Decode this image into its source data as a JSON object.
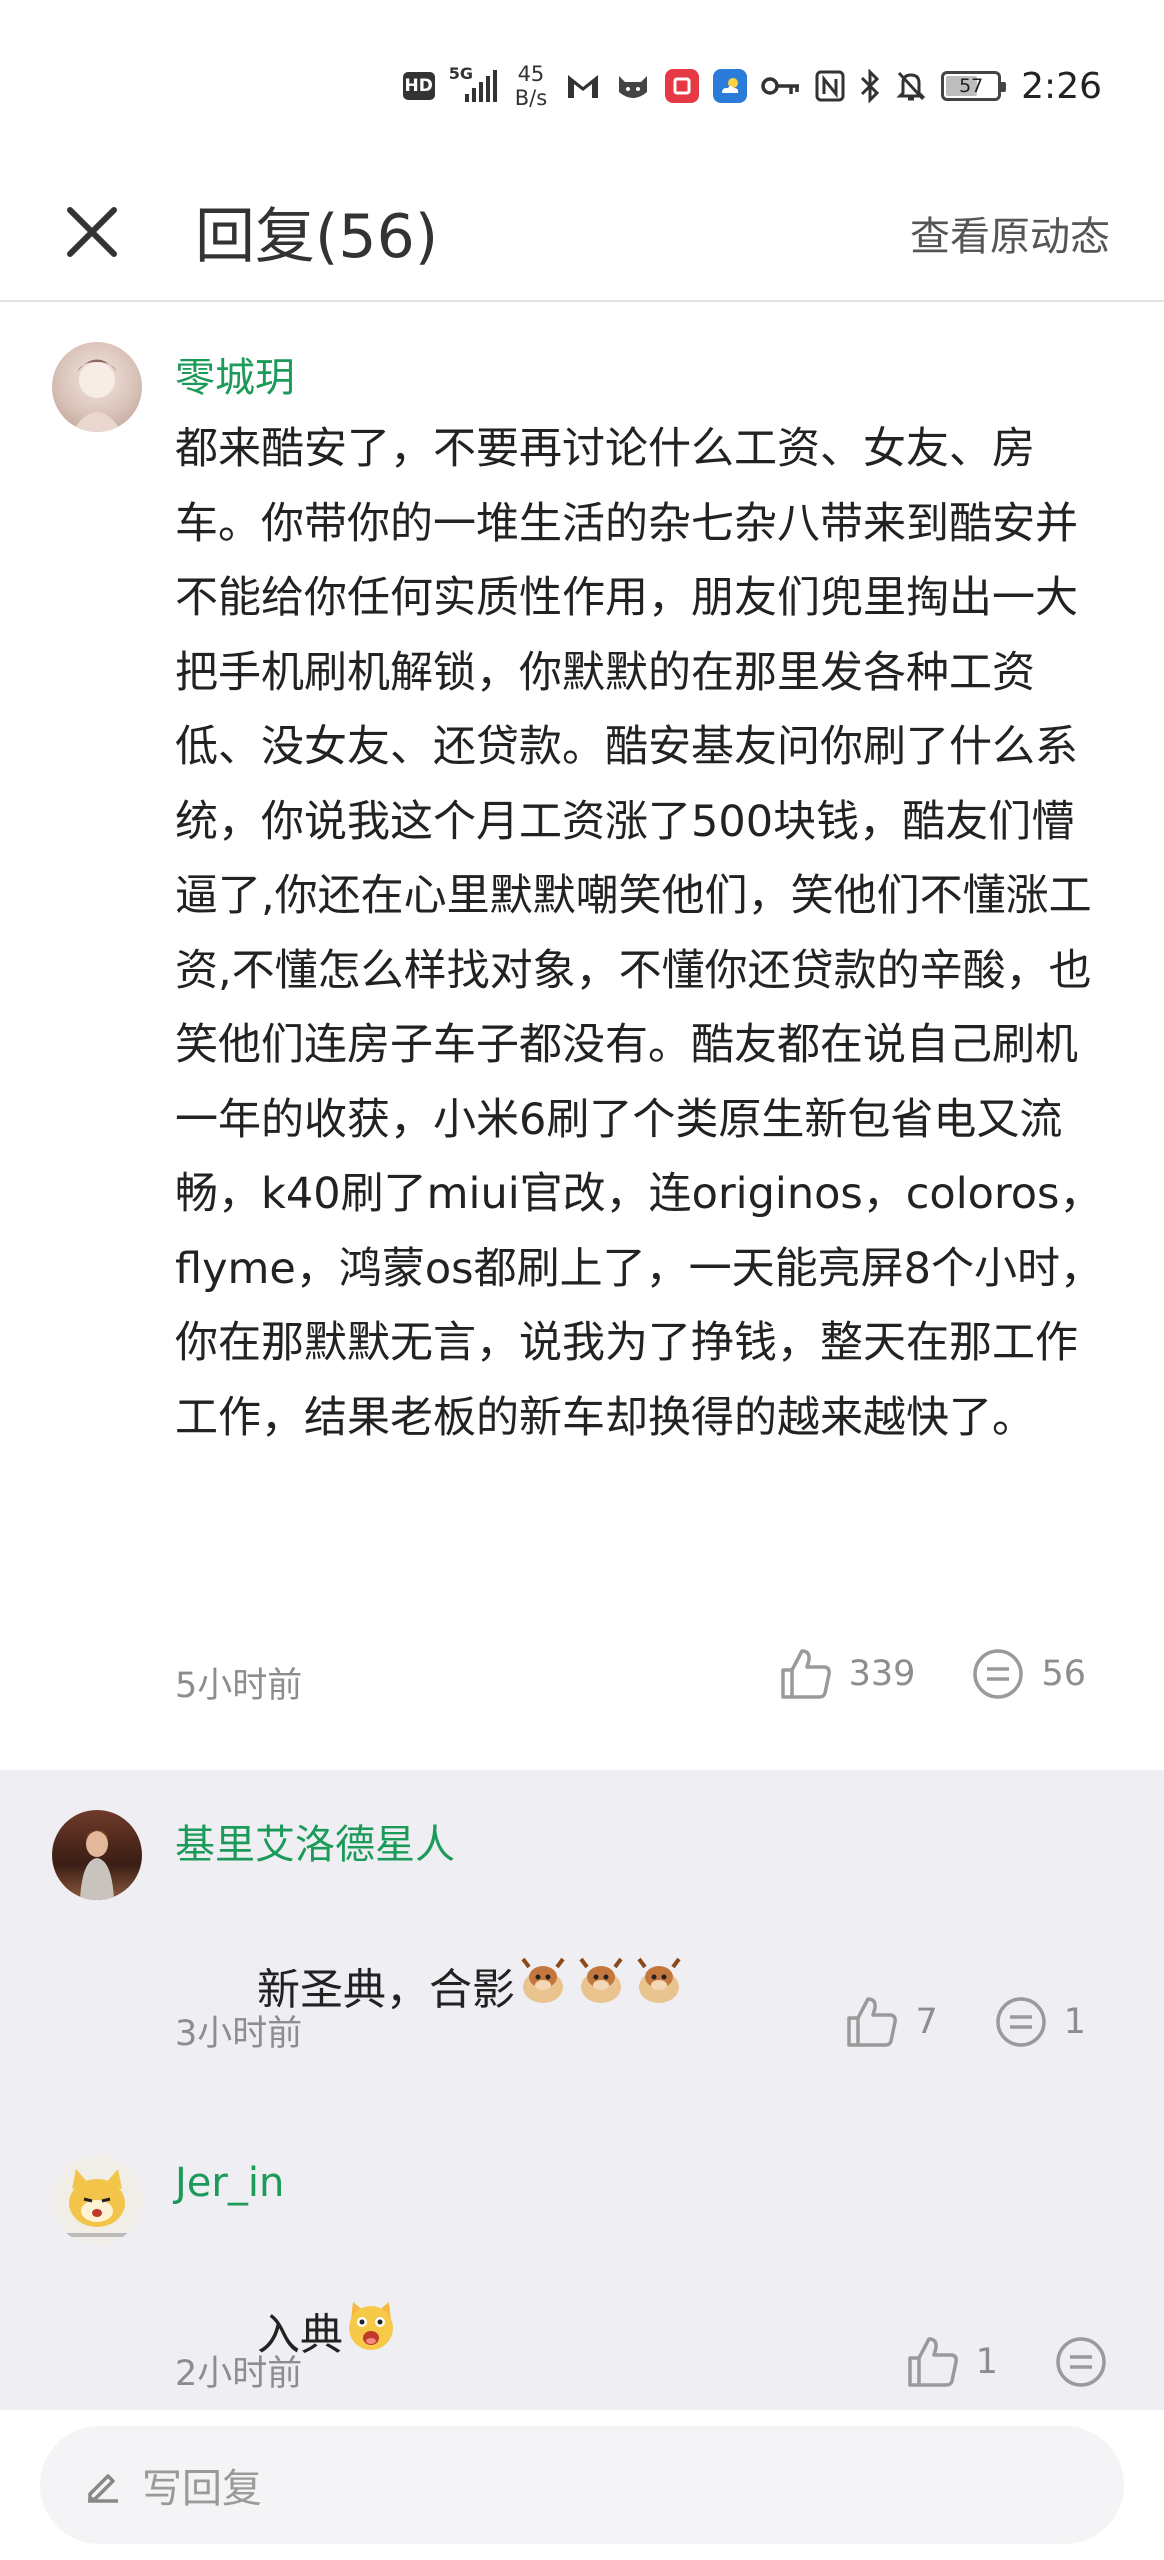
{
  "status_bar": {
    "hd": "HD",
    "network_gen": "5G",
    "net_speed_value": "45",
    "net_speed_unit": "B/s",
    "battery": "57",
    "time": "2:26"
  },
  "header": {
    "title": "回复(56)",
    "action": "查看原动态"
  },
  "main_comment": {
    "username": "零城玥",
    "text": "都来酷安了，不要再讨论什么工资、女友、房车。你带你的一堆生活的杂七杂八带来到酷安并不能给你任何实质性作用，朋友们兜里掏出一大把手机刷机解锁，你默默的在那里发各种工资低、没女友、还贷款。酷安基友问你刷了什么系统，你说我这个月工资涨了500块钱，酷友们懵逼了,你还在心里默默嘲笑他们，笑他们不懂涨工资,不懂怎么样找对象，不懂你还贷款的辛酸，也笑他们连房子车子都没有。酷友都在说自己刷机一年的收获，小米6刷了个类原生新包省电又流畅，k40刷了miui官改，连originos，coloros，flyme，鸿蒙os都刷上了，一天能亮屏8个小时，你在那默默无言，说我为了挣钱，整天在那工作工作，结果老板的新车却换得的越来越快了。",
    "time": "5小时前",
    "likes": "339",
    "replies": "56"
  },
  "replies": [
    {
      "username": "基里艾洛德星人",
      "text": "新圣典，合影",
      "time": "3小时前",
      "likes": "7",
      "replies": "1"
    },
    {
      "username": "Jer_in",
      "text": "入典",
      "time": "2小时前",
      "likes": "1",
      "replies": ""
    }
  ],
  "bottom_bar": {
    "placeholder": "写回复"
  }
}
